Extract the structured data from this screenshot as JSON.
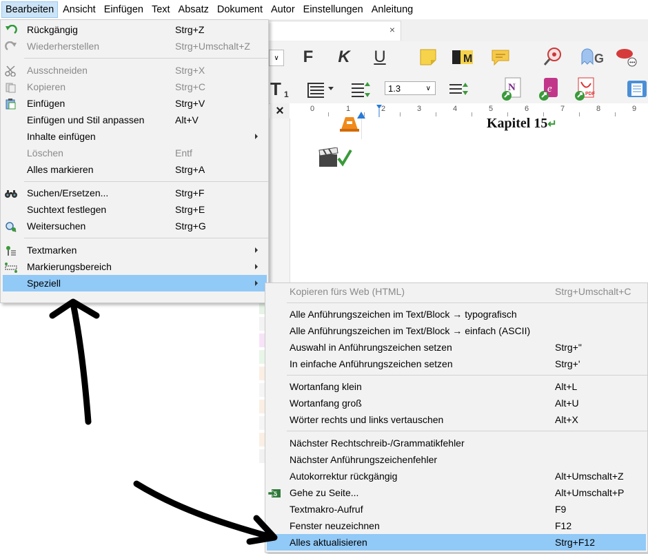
{
  "menubar": {
    "items": [
      "Bearbeiten",
      "Ansicht",
      "Einfügen",
      "Text",
      "Absatz",
      "Dokument",
      "Autor",
      "Einstellungen",
      "Anleitung"
    ]
  },
  "tab": {
    "close_glyph": "×"
  },
  "toolbar": {
    "bold": "F",
    "italic": "K",
    "underline": "U",
    "line_spacing": "1.3",
    "panel_close": "×"
  },
  "ruler": {
    "ticks": [
      "0",
      "1",
      "2",
      "3",
      "4",
      "5",
      "6",
      "7",
      "8",
      "9"
    ]
  },
  "document": {
    "heading": "Kapitel 15"
  },
  "edit_menu": {
    "items": [
      {
        "label": "Rückgängig",
        "shortcut": "Strg+Z",
        "icon": "undo-icon"
      },
      {
        "label": "Wiederherstellen",
        "shortcut": "Strg+Umschalt+Z",
        "icon": "redo-icon"
      },
      {
        "label": "Ausschneiden",
        "shortcut": "Strg+X",
        "icon": "scissors-icon"
      },
      {
        "label": "Kopieren",
        "shortcut": "Strg+C",
        "icon": "copy-icon"
      },
      {
        "label": "Einfügen",
        "shortcut": "Strg+V",
        "icon": "paste-icon"
      },
      {
        "label": "Einfügen und Stil anpassen",
        "shortcut": "Alt+V"
      },
      {
        "label": "Inhalte einfügen",
        "shortcut": ""
      },
      {
        "label": "Löschen",
        "shortcut": "Entf"
      },
      {
        "label": "Alles markieren",
        "shortcut": "Strg+A"
      },
      {
        "label": "Suchen/Ersetzen...",
        "shortcut": "Strg+F",
        "icon": "binoculars-icon"
      },
      {
        "label": "Suchtext festlegen",
        "shortcut": "Strg+E"
      },
      {
        "label": "Weitersuchen",
        "shortcut": "Strg+G",
        "icon": "find-next-icon"
      },
      {
        "label": "Textmarken",
        "shortcut": "",
        "icon": "bookmark-pin-icon"
      },
      {
        "label": "Markierungsbereich",
        "shortcut": "",
        "icon": "selection-range-icon"
      },
      {
        "label": "Speziell",
        "shortcut": ""
      }
    ]
  },
  "special_menu": {
    "items": [
      {
        "label": "Kopieren fürs Web (HTML)",
        "shortcut": "Strg+Umschalt+C"
      },
      {
        "label": "Alle Anführungszeichen im Text/Block → typografisch",
        "shortcut": ""
      },
      {
        "label": "Alle Anführungszeichen im Text/Block → einfach (ASCII)",
        "shortcut": ""
      },
      {
        "label": "Auswahl in Anführungszeichen setzen",
        "shortcut": "Strg+\""
      },
      {
        "label": "In einfache Anführungszeichen setzen",
        "shortcut": "Strg+'"
      },
      {
        "label": "Wortanfang klein",
        "shortcut": "Alt+L"
      },
      {
        "label": "Wortanfang groß",
        "shortcut": "Alt+U"
      },
      {
        "label": "Wörter rechts und links vertauschen",
        "shortcut": "Alt+X"
      },
      {
        "label": "Nächster Rechtschreib-/Grammatikfehler",
        "shortcut": ""
      },
      {
        "label": "Nächster Anführungszeichenfehler",
        "shortcut": ""
      },
      {
        "label": "Autokorrektur rückgängig",
        "shortcut": "Alt+Umschalt+Z"
      },
      {
        "label": "Gehe zu Seite...",
        "shortcut": "Alt+Umschalt+P",
        "icon": "goto-page-icon"
      },
      {
        "label": "Textmakro-Aufruf",
        "shortcut": "F9"
      },
      {
        "label": "Fenster neuzeichnen",
        "shortcut": "F12"
      },
      {
        "label": "Alles aktualisieren",
        "shortcut": "Strg+F12"
      }
    ]
  },
  "colors": {
    "highlight": "#91c9f7",
    "menubar_active": "#cce4f7",
    "menu_bg": "#f2f2f2"
  }
}
